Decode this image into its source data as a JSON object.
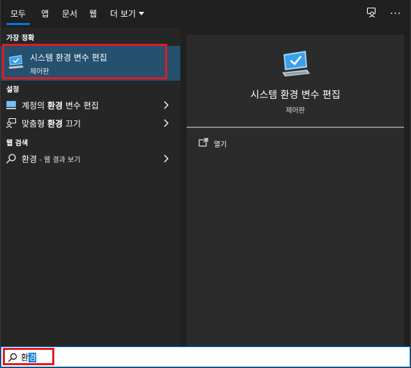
{
  "tabs": [
    {
      "label": "모두",
      "active": true
    },
    {
      "label": "앱"
    },
    {
      "label": "문서"
    },
    {
      "label": "웹"
    },
    {
      "label": "더 보기"
    }
  ],
  "toolbar": {
    "feedback_icon": "person-feedback-icon",
    "more_icon": "ellipsis-icon",
    "more_glyph": "···"
  },
  "left": {
    "best_match_label": "가장 정확",
    "best_match": {
      "title": "시스템 환경 변수 편집",
      "subtitle": "제어판",
      "icon": "monitor-check-icon"
    },
    "settings_label": "설정",
    "settings": [
      {
        "pre": "계정의 ",
        "bold": "환경",
        "post": " 변수 편집",
        "icon": "monitor-settings-icon"
      },
      {
        "pre": "맞춤형 ",
        "bold": "환경",
        "post": " 끄기",
        "icon": "person-chat-icon"
      }
    ],
    "web_label": "웹 검색",
    "web": {
      "bold": "환경",
      "dim": " - 웹 결과 보기",
      "icon": "search-icon"
    }
  },
  "right": {
    "title": "시스템 환경 변수 편집",
    "subtitle": "제어판",
    "action_label": "열기",
    "action_icon": "open-window-icon"
  },
  "search": {
    "typed": "환",
    "selected": "경"
  },
  "colors": {
    "accent": "#0078d7",
    "highlight": "#e01b24",
    "best_bg": "#25506e"
  }
}
